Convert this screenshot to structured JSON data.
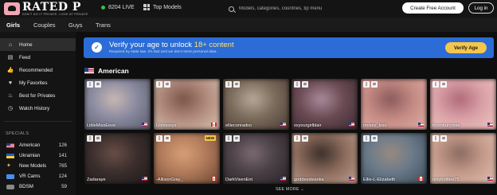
{
  "header": {
    "logo_text": "RATED P",
    "logo_tagline": "DON'T DO IT PRIVATE, LOOK AT PRIVATE",
    "live_count": "8204 LIVE",
    "top_models_label": "Top Models",
    "search_placeholder": "Models, categories, countries, tip menu",
    "create_account_label": "Create Free Account",
    "login_label": "Log in"
  },
  "categories": [
    "Girls",
    "Couples",
    "Guys",
    "Trans"
  ],
  "sidebar": {
    "items": [
      {
        "label": "Home",
        "icon": "home-icon",
        "active": true
      },
      {
        "label": "Feed",
        "icon": "feed-icon"
      },
      {
        "label": "Recommended",
        "icon": "thumbs-up-icon"
      },
      {
        "label": "My Favorites",
        "icon": "heart-icon"
      },
      {
        "label": "Best for Privates",
        "icon": "flame-icon"
      },
      {
        "label": "Watch History",
        "icon": "history-icon"
      }
    ],
    "specials_title": "SPECIALS",
    "specials": [
      {
        "label": "American",
        "count": "126",
        "flag": "us"
      },
      {
        "label": "Ukrainian",
        "count": "141",
        "flag": "ua"
      },
      {
        "label": "New Models",
        "count": "765",
        "flag": "new"
      },
      {
        "label": "VR Cams",
        "count": "124",
        "flag": "vr"
      },
      {
        "label": "BDSM",
        "count": "59",
        "flag": "bdsm"
      }
    ]
  },
  "banner": {
    "title_prefix": "Verify your age to unlock ",
    "title_highlight": "18+ content",
    "subtitle": "Required by state law. It's fast and we don't store personal data.",
    "button_label": "Verify Age",
    "color": "#2b6cd6",
    "button_color": "#f4c64b"
  },
  "section": {
    "title": "American",
    "see_more_label": "SEE MORE"
  },
  "models": [
    {
      "name": "LittleMissEeve",
      "flag": "us",
      "colors": [
        "#8a8aa0",
        "#c9b9b4",
        "#5a5a6a"
      ]
    },
    {
      "name": "Lilmissvyx",
      "flag": "ca",
      "colors": [
        "#b08a7c",
        "#7a5548",
        "#d8c2b0"
      ]
    },
    {
      "name": "ellieconradxo",
      "flag": "us",
      "colors": [
        "#7a6a5a",
        "#b8a89a",
        "#4a3c34"
      ]
    },
    {
      "name": "xxyourgirlblair",
      "flag": "us",
      "colors": [
        "#6a4a52",
        "#a88a9a",
        "#3a2a32"
      ]
    },
    {
      "name": "mosey_kiss",
      "flag": "us",
      "colors": [
        "#c48a84",
        "#8a5a5a",
        "#e0b0a4"
      ]
    },
    {
      "name": "thornburyrose",
      "flag": "us",
      "colors": [
        "#d9a0a6",
        "#b06a7a",
        "#f0c8c0"
      ]
    },
    {
      "name": "Zadaraye",
      "flag": "us",
      "colors": [
        "#3a2e2c",
        "#6a4e48",
        "#1e1818"
      ]
    },
    {
      "name": "-AllisonGray_",
      "flag": "ca",
      "colors": [
        "#b07a5a",
        "#d8a078",
        "#6a4430"
      ],
      "new": "NEW"
    },
    {
      "name": "DarkVixenEnt",
      "flag": "us",
      "colors": [
        "#4a4046",
        "#7a6a70",
        "#2a2226"
      ]
    },
    {
      "name": "goddessbianka",
      "flag": "us",
      "colors": [
        "#8a6a5a",
        "#3a2e2a",
        "#c0a090"
      ]
    },
    {
      "name": "Ellie-L-Elizabeth",
      "flag": "ca",
      "colors": [
        "#6a7a8a",
        "#9a8a80",
        "#3a4a58"
      ]
    },
    {
      "name": "onlyhotbbe75",
      "flag": "us",
      "colors": [
        "#c49a8a",
        "#8a6a60",
        "#e0c0b0"
      ]
    }
  ]
}
